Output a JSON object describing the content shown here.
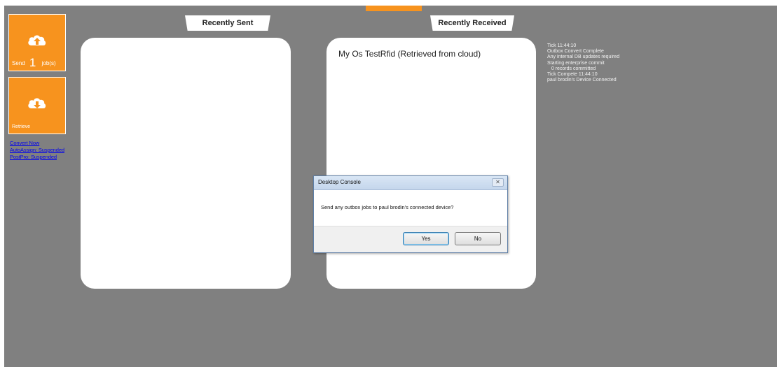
{
  "tiles": {
    "send": {
      "label": "Send",
      "count": "1",
      "suffix": "job(s)"
    },
    "retrieve": {
      "label": "Retrieve"
    }
  },
  "links": [
    "Convert Now",
    "AutoAssign: Suspended",
    "PostPro: Suspended"
  ],
  "tabs": {
    "sent": "Recently Sent",
    "received": "Recently Received"
  },
  "received_items": [
    "My Os TestRfid (Retrieved from cloud)"
  ],
  "log": [
    "Tick 11:44:10",
    "Outbox Convert Complete",
    "Any internal DB updates required",
    "Starting enterprise commit",
    "   0 records committed",
    "Tick Compete 11:44:10",
    "paul brodin's Device Connected"
  ],
  "dialog": {
    "title": "Desktop Console",
    "message": "Send any outbox jobs to paul brodin's connected device?",
    "yes_label": "Yes",
    "no_label": "No",
    "close_glyph": "✕"
  },
  "colors": {
    "accent": "#f7931e",
    "background": "#808080",
    "link": "#0000ee"
  },
  "icons": {
    "send": "cloud-upload-icon",
    "retrieve": "cloud-download-icon"
  }
}
